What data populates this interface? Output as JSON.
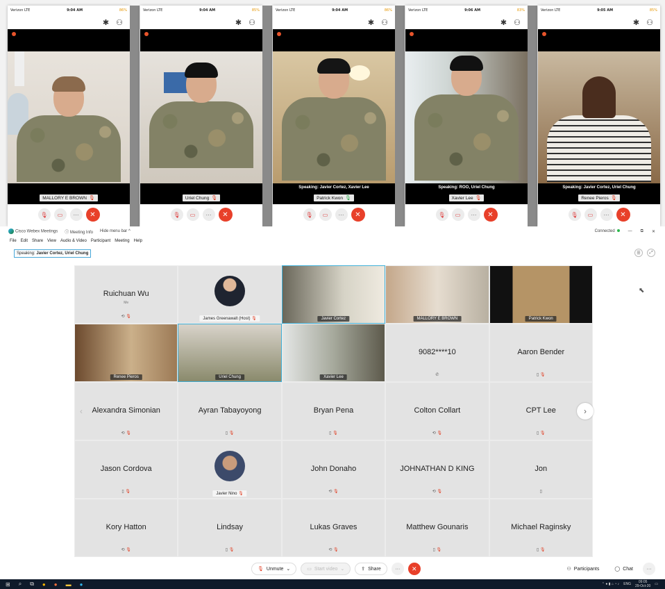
{
  "phones": [
    {
      "carrier": "Verizon  LTE",
      "time": "9:04 AM",
      "battery": "86%",
      "speaking": "",
      "name": "MALLORY E BROWN"
    },
    {
      "carrier": "Verizon  LTE",
      "time": "9:04 AM",
      "battery": "85%",
      "speaking": "",
      "name": "Uriel Chung"
    },
    {
      "carrier": "Verizon  LTE",
      "time": "9:04 AM",
      "battery": "86%",
      "speaking": "Speaking: Javier Cortez, Xavier Lee",
      "name": "Patrick Kwon"
    },
    {
      "carrier": "Verizon  LTE",
      "time": "9:06 AM",
      "battery": "83%",
      "speaking": "Speaking: ROO, Uriel Chung",
      "name": "Xavier Lee"
    },
    {
      "carrier": "Verizon  LTE",
      "time": "9:05 AM",
      "battery": "85%",
      "speaking": "Speaking: Javier Cortez, Uriel Chung",
      "name": "Renee Pieros"
    }
  ],
  "window": {
    "app_name": "Cisco Webex Meetings",
    "meeting_info": "Meeting Info",
    "hide_menu": "Hide menu bar",
    "connected": "Connected"
  },
  "menu": [
    "File",
    "Edit",
    "Share",
    "View",
    "Audio & Video",
    "Participant",
    "Meeting",
    "Help"
  ],
  "speaking": {
    "prefix": "Speaking:",
    "names": "Javier Cortez, Uriel Chung"
  },
  "tiles": {
    "ruichuan": {
      "name": "Ruichuan Wu",
      "sub": "Me"
    },
    "greenawalt": {
      "label": "James Greenawalt (Host)"
    },
    "cortez": {
      "label": "Javier Cortez"
    },
    "brown": {
      "label": "MALLORY E BROWN"
    },
    "kwon": {
      "label": "Patrick Kwon"
    },
    "pieros": {
      "label": "Renee Pieros"
    },
    "chung": {
      "label": "Uriel Chung"
    },
    "lee": {
      "label": "Xavier Lee"
    },
    "phone_number": {
      "name": "9082****10"
    },
    "bender": {
      "name": "Aaron Bender"
    },
    "simonian": {
      "name": "Alexandra Simonian"
    },
    "tabayoyong": {
      "name": "Ayran Tabayoyong"
    },
    "pena": {
      "name": "Bryan Pena"
    },
    "collart": {
      "name": "Colton Collart"
    },
    "cptlee": {
      "name": "CPT Lee"
    },
    "cordova": {
      "name": "Jason Cordova"
    },
    "nino": {
      "label": "Javier Nino"
    },
    "donaho": {
      "name": "John Donaho"
    },
    "king": {
      "name": "JOHNATHAN D KING"
    },
    "jon": {
      "name": "Jon"
    },
    "hatton": {
      "name": "Kory Hatton"
    },
    "lindsay": {
      "name": "Lindsay"
    },
    "graves": {
      "name": "Lukas Graves"
    },
    "gounaris": {
      "name": "Matthew Gounaris"
    },
    "raginsky": {
      "name": "Michael Raginsky"
    }
  },
  "controls": {
    "unmute": "Unmute",
    "start_video": "Start video",
    "share": "Share",
    "participants": "Participants",
    "chat": "Chat"
  },
  "taskbar": {
    "language": "ENG",
    "clock_time": "09:05",
    "clock_date": "29-Oct-20"
  },
  "colors": {
    "accent": "#3fb0d9",
    "end_call": "#e8402a",
    "muted_mic": "#e03a1e"
  }
}
